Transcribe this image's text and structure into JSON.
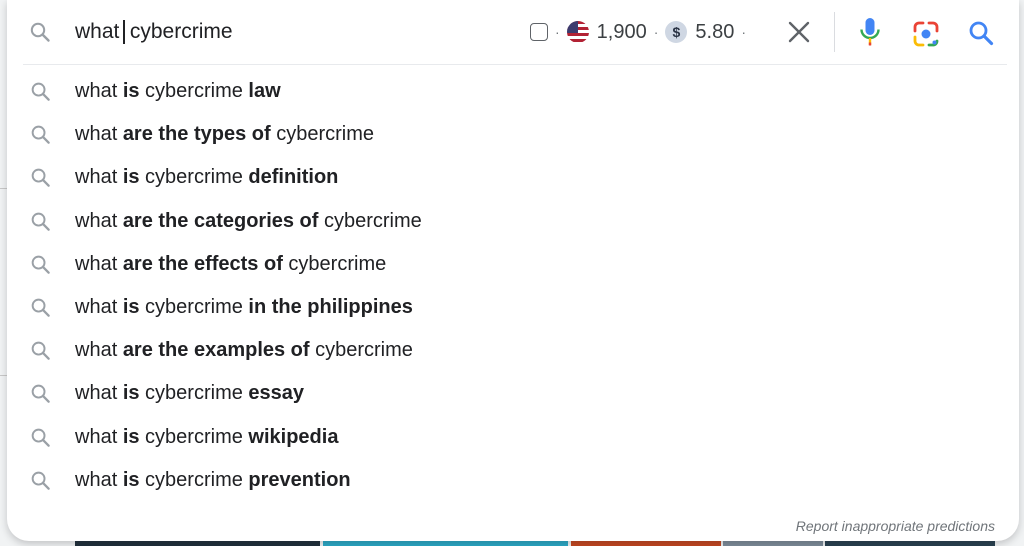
{
  "search": {
    "query_before_cursor": "what",
    "query_after_cursor": "cybercrime"
  },
  "extension": {
    "volume": "1,900",
    "currency_symbol": "$",
    "cpc": "5.80",
    "separator": "·"
  },
  "icons": {
    "clear": "close-icon",
    "voice": "microphone-icon",
    "lens": "google-lens-icon",
    "submit": "search-icon",
    "suggestion": "search-icon",
    "flag": "us-flag-icon"
  },
  "suggestions": [
    {
      "parts": [
        {
          "t": "what ",
          "b": false
        },
        {
          "t": "is",
          "b": true
        },
        {
          "t": " cybercrime ",
          "b": false
        },
        {
          "t": "law",
          "b": true
        }
      ]
    },
    {
      "parts": [
        {
          "t": "what ",
          "b": false
        },
        {
          "t": "are the types of",
          "b": true
        },
        {
          "t": " cybercrime",
          "b": false
        }
      ]
    },
    {
      "parts": [
        {
          "t": "what ",
          "b": false
        },
        {
          "t": "is",
          "b": true
        },
        {
          "t": " cybercrime ",
          "b": false
        },
        {
          "t": "definition",
          "b": true
        }
      ]
    },
    {
      "parts": [
        {
          "t": "what ",
          "b": false
        },
        {
          "t": "are the categories of",
          "b": true
        },
        {
          "t": " cybercrime",
          "b": false
        }
      ]
    },
    {
      "parts": [
        {
          "t": "what ",
          "b": false
        },
        {
          "t": "are the effects of",
          "b": true
        },
        {
          "t": " cybercrime",
          "b": false
        }
      ]
    },
    {
      "parts": [
        {
          "t": "what ",
          "b": false
        },
        {
          "t": "is",
          "b": true
        },
        {
          "t": " cybercrime ",
          "b": false
        },
        {
          "t": "in the philippines",
          "b": true
        }
      ]
    },
    {
      "parts": [
        {
          "t": "what ",
          "b": false
        },
        {
          "t": "are the examples of",
          "b": true
        },
        {
          "t": " cybercrime",
          "b": false
        }
      ]
    },
    {
      "parts": [
        {
          "t": "what ",
          "b": false
        },
        {
          "t": "is",
          "b": true
        },
        {
          "t": " cybercrime ",
          "b": false
        },
        {
          "t": "essay",
          "b": true
        }
      ]
    },
    {
      "parts": [
        {
          "t": "what ",
          "b": false
        },
        {
          "t": "is",
          "b": true
        },
        {
          "t": " cybercrime ",
          "b": false
        },
        {
          "t": "wikipedia",
          "b": true
        }
      ]
    },
    {
      "parts": [
        {
          "t": "what ",
          "b": false
        },
        {
          "t": "is",
          "b": true
        },
        {
          "t": " cybercrime ",
          "b": false
        },
        {
          "t": "prevention",
          "b": true
        }
      ]
    }
  ],
  "report_link": "Report inappropriate predictions",
  "colors": {
    "accent_blue": "#4285f4",
    "mic_red": "#ea4335",
    "text": "#202124",
    "muted": "#70757a"
  }
}
